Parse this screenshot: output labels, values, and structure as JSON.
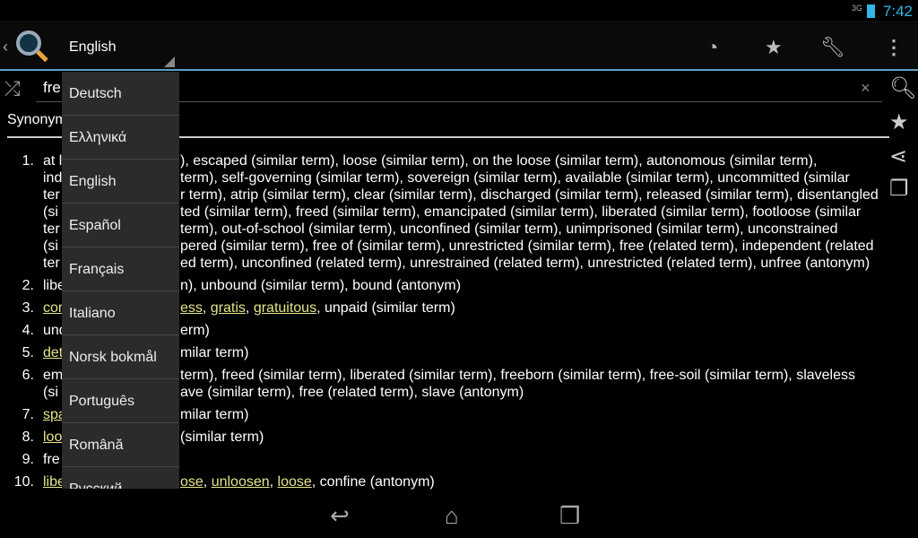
{
  "status": {
    "signal": "3G",
    "time": "7:42"
  },
  "actionbar": {
    "language": "English",
    "icons": [
      "back-chevron-icon",
      "magnifier-logo-icon",
      "history-icon",
      "star-icon",
      "wrench-icon",
      "overflow-menu-icon"
    ]
  },
  "search": {
    "query": "fre",
    "clear": "×"
  },
  "section_title": "Synonym",
  "side_icons": [
    "search-icon",
    "star-icon",
    "share-icon",
    "copy-icon"
  ],
  "entries": [
    {
      "num": "1.",
      "lines": [
        {
          "pre": [
            {
              "t": "at l"
            }
          ],
          "post": [
            {
              "t": "), escaped (similar term), loose (similar term), on the loose (similar term), autonomous (similar term),"
            }
          ]
        },
        {
          "pre": [
            {
              "t": "ind"
            }
          ],
          "post": [
            {
              "t": "term), self-governing (similar term), sovereign (similar term), available (similar term), uncommitted (similar"
            }
          ]
        },
        {
          "pre": [
            {
              "t": "ter"
            }
          ],
          "post": [
            {
              "t": "r term), atrip (similar term), clear (similar term), discharged (similar term), released (similar term), disentangled"
            }
          ]
        },
        {
          "pre": [
            {
              "t": "(si"
            }
          ],
          "post": [
            {
              "t": "ted (similar term), freed (similar term), emancipated (similar term), liberated (similar term), footloose (similar"
            }
          ]
        },
        {
          "pre": [
            {
              "t": "ter"
            }
          ],
          "post": [
            {
              "t": "term), out-of-school (similar term), unconfined (similar term), unimprisoned (similar term), unconstrained"
            }
          ]
        },
        {
          "pre": [
            {
              "t": "(si"
            }
          ],
          "post": [
            {
              "t": "pered (similar term), free of (similar term), unrestricted (similar term), free (related term), independent (related"
            }
          ]
        },
        {
          "pre": [
            {
              "t": "ter"
            }
          ],
          "post": [
            {
              "t": "ed term), unconfined (related term), unrestrained (related term), unrestricted (related term), unfree (antonym)"
            }
          ]
        }
      ]
    },
    {
      "num": "2.",
      "lines": [
        {
          "pre": [
            {
              "t": "libe"
            }
          ],
          "post": [
            {
              "t": "n), unbound (similar term), bound (antonym)"
            }
          ]
        }
      ]
    },
    {
      "num": "3.",
      "lines": [
        {
          "pre": [
            {
              "t": "cor",
              "link": true
            }
          ],
          "post": [
            {
              "t": "ess",
              "link": true
            },
            {
              "t": ", "
            },
            {
              "t": "gratis",
              "link": true
            },
            {
              "t": ", "
            },
            {
              "t": "gratuitous",
              "link": true
            },
            {
              "t": ", unpaid (similar term)"
            }
          ]
        }
      ]
    },
    {
      "num": "4.",
      "lines": [
        {
          "pre": [
            {
              "t": "und"
            }
          ],
          "post": [
            {
              "t": "erm)"
            }
          ]
        }
      ]
    },
    {
      "num": "5.",
      "lines": [
        {
          "pre": [
            {
              "t": "det",
              "link": true
            }
          ],
          "post": [
            {
              "t": "milar term)"
            }
          ]
        }
      ]
    },
    {
      "num": "6.",
      "lines": [
        {
          "pre": [
            {
              "t": "em"
            }
          ],
          "post": [
            {
              "t": " term), freed (similar term), liberated (similar term), freeborn (similar term), free-soil (similar term), slaveless"
            }
          ]
        },
        {
          "pre": [
            {
              "t": "(si"
            }
          ],
          "post": [
            {
              "t": "ave (similar term), free (related term), slave (antonym)"
            }
          ]
        }
      ]
    },
    {
      "num": "7.",
      "lines": [
        {
          "pre": [
            {
              "t": "spa",
              "link": true
            }
          ],
          "post": [
            {
              "t": "milar term)"
            }
          ]
        }
      ]
    },
    {
      "num": "8.",
      "lines": [
        {
          "pre": [
            {
              "t": "loo",
              "link": true
            }
          ],
          "post": [
            {
              "t": "(similar term)"
            }
          ]
        }
      ]
    },
    {
      "num": "9.",
      "lines": [
        {
          "pre": [
            {
              "t": "fre"
            }
          ],
          "post": []
        }
      ]
    },
    {
      "num": "10.",
      "lines": [
        {
          "pre": [
            {
              "t": "libe",
              "link": true
            }
          ],
          "post": [
            {
              "t": "ose",
              "link": true
            },
            {
              "t": ", "
            },
            {
              "t": "unloosen",
              "link": true
            },
            {
              "t": ", "
            },
            {
              "t": "loose",
              "link": true
            },
            {
              "t": ", confine (antonym)"
            }
          ]
        }
      ]
    }
  ],
  "dropdown": [
    "Deutsch",
    "Ελληνικά",
    "English",
    "Español",
    "Français",
    "Italiano",
    "Norsk bokmål",
    "Português",
    "Română",
    "Русский"
  ],
  "navbar": [
    "back-icon",
    "home-icon",
    "recent-apps-icon"
  ],
  "colors": {
    "accent": "#33b5e5",
    "link": "#e5e58a",
    "divider": "#5b9fc7"
  }
}
